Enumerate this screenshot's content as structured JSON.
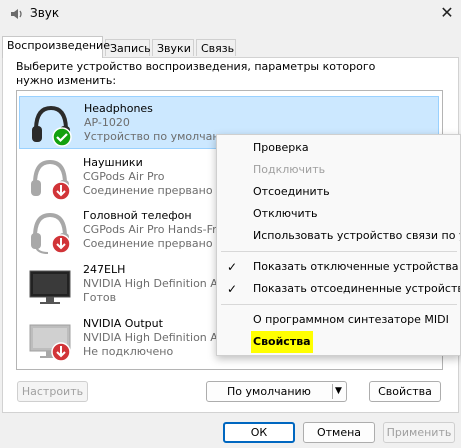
{
  "window": {
    "title": "Звук"
  },
  "tabs": [
    {
      "label": "Воспроизведение"
    },
    {
      "label": "Запись"
    },
    {
      "label": "Звуки"
    },
    {
      "label": "Связь"
    }
  ],
  "instructions": "Выберите устройство воспроизведения, параметры которого нужно изменить:",
  "devices": [
    {
      "name": "Headphones",
      "line1": "AP-1020",
      "line2": "Устройство по умолчанию",
      "icon": "headphones-icon",
      "status_icon": "default-check-icon"
    },
    {
      "name": "Наушники",
      "line1": "CGPods Air Pro",
      "line2": "Соединение прервано",
      "icon": "headphones-icon",
      "status_icon": "disconnected-arrow-icon"
    },
    {
      "name": "Головной телефон",
      "line1": "CGPods Air Pro Hands-Free",
      "line2": "Соединение прервано",
      "icon": "headset-icon",
      "status_icon": "disconnected-arrow-icon"
    },
    {
      "name": "247ELH",
      "line1": "NVIDIA High Definition Au",
      "line2": "Готов",
      "icon": "monitor-icon",
      "status_icon": ""
    },
    {
      "name": "NVIDIA Output",
      "line1": "NVIDIA High Definition Au",
      "line2": "Не подключено",
      "icon": "monitor-icon",
      "status_icon": "disconnected-arrow-icon"
    }
  ],
  "context_menu": {
    "items": [
      {
        "label": "Проверка"
      },
      {
        "label": "Подключить"
      },
      {
        "label": "Отсоединить"
      },
      {
        "label": "Отключить"
      },
      {
        "label": "Использовать устройство связи по умолчанию"
      },
      {
        "label": "Показать отключенные устройства"
      },
      {
        "label": "Показать отсоединенные устройства"
      },
      {
        "label": "О программном синтезаторе MIDI"
      },
      {
        "label": "Свойства"
      }
    ]
  },
  "buttons": {
    "configure": "Настроить",
    "set_default": "По умолчанию",
    "properties": "Свойства",
    "ok": "ОК",
    "cancel": "Отмена",
    "apply": "Применить"
  },
  "colors": {
    "selection": "#cce8ff",
    "accent": "#0067c0",
    "highlight": "#ffff00",
    "default_badge": "#13a10e",
    "disconnected_badge": "#d13438"
  }
}
